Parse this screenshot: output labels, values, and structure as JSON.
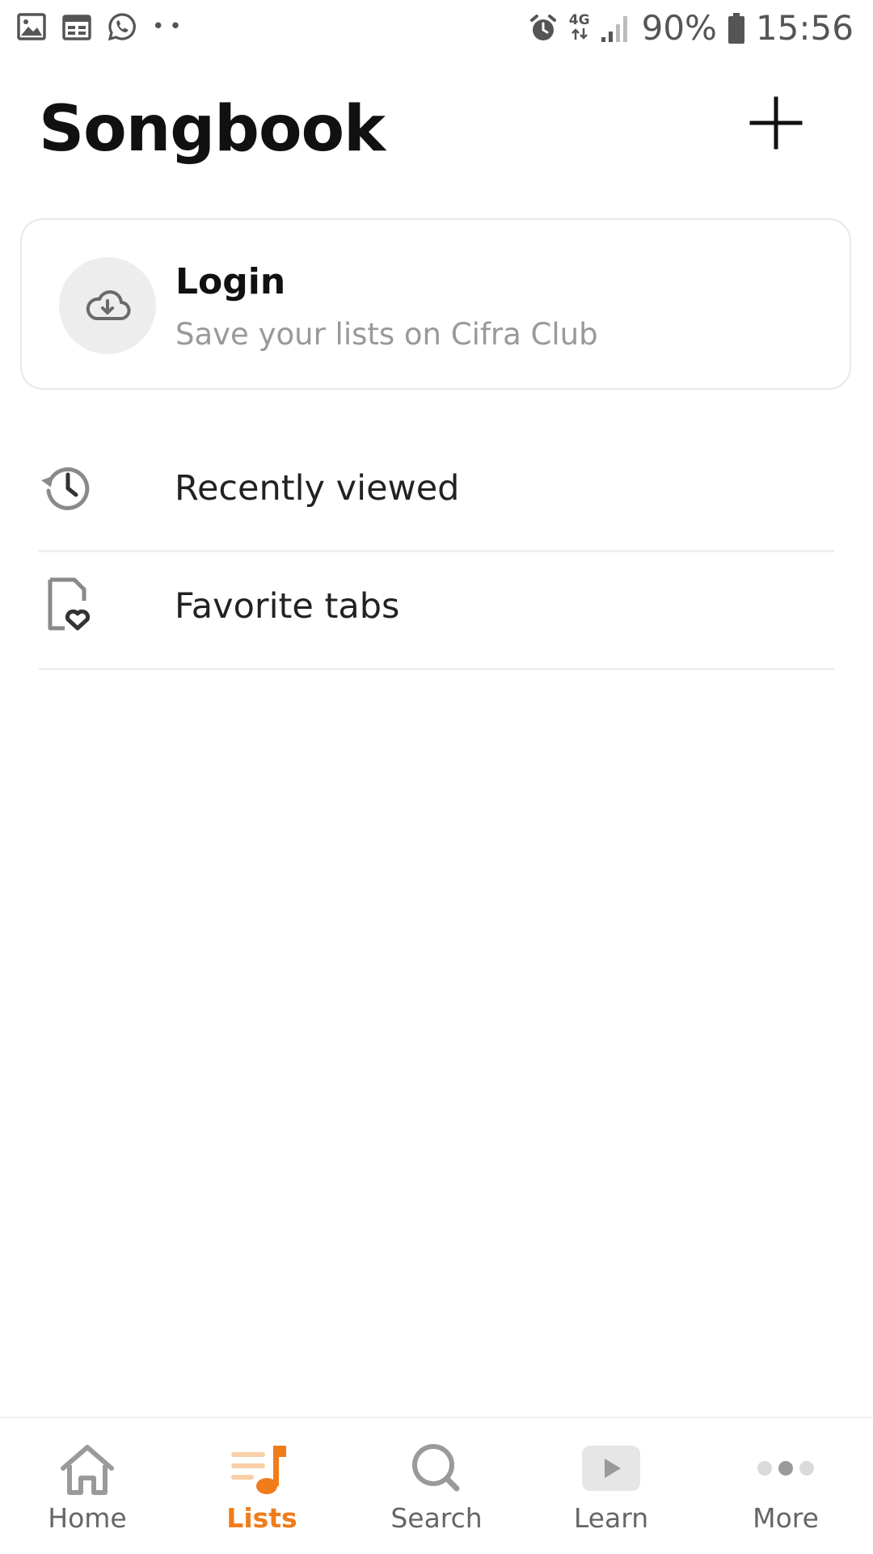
{
  "status_bar": {
    "left_icons": [
      "gallery-icon",
      "calendar-icon",
      "whatsapp-icon"
    ],
    "dots": "••",
    "network": "4G",
    "battery": "90%",
    "time": "15:56"
  },
  "header": {
    "title": "Songbook",
    "add_icon": "plus-icon"
  },
  "login_card": {
    "icon": "cloud-download-icon",
    "title": "Login",
    "subtitle": "Save your lists on Cifra Club"
  },
  "list": {
    "items": [
      {
        "label": "Recently viewed",
        "icon": "history-icon"
      },
      {
        "label": "Favorite tabs",
        "icon": "favorite-file-icon"
      }
    ]
  },
  "bottom_nav": {
    "items": [
      {
        "label": "Home",
        "icon": "home-icon",
        "active": false
      },
      {
        "label": "Lists",
        "icon": "lists-icon",
        "active": true
      },
      {
        "label": "Search",
        "icon": "search-icon",
        "active": false
      },
      {
        "label": "Learn",
        "icon": "play-icon",
        "active": false
      },
      {
        "label": "More",
        "icon": "more-icon",
        "active": false
      }
    ]
  },
  "colors": {
    "accent": "#f07c1a",
    "accent_light": "#f9cfa6",
    "inactive": "#9a9a9a"
  }
}
